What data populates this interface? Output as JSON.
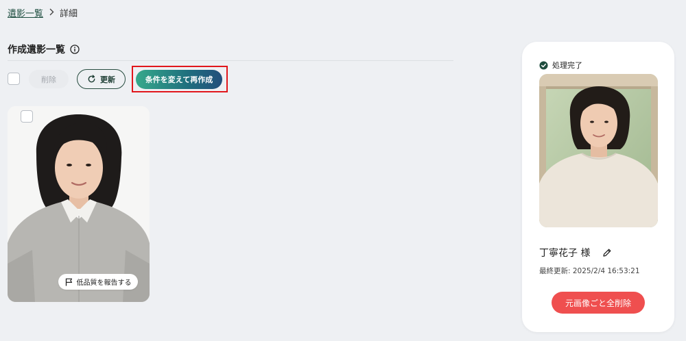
{
  "breadcrumb": {
    "parent": "遺影一覧",
    "current": "詳細"
  },
  "section": {
    "title": "作成遺影一覧"
  },
  "toolbar": {
    "delete_label": "削除",
    "refresh_label": "更新",
    "remake_label": "条件を変えて再作成"
  },
  "generated": {
    "report_label": "低品質を報告する"
  },
  "detail": {
    "status": "処理完了",
    "name": "丁寧花子 様",
    "updated": "最終更新: 2025/2/4 16:53:21",
    "delete_all_label": "元画像ごと全削除"
  },
  "colors": {
    "status_green": "#1f4d3e",
    "remake_gradient_start": "#36a98b",
    "remake_gradient_end": "#224e7c",
    "danger": "#ef4f4f",
    "highlight": "#e1161b"
  },
  "icons": [
    "chevron-right-icon",
    "info-icon",
    "refresh-icon",
    "flag-icon",
    "check-circle-icon",
    "pencil-icon"
  ]
}
